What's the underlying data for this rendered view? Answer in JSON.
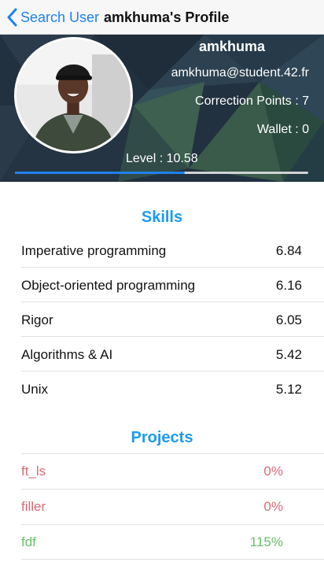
{
  "nav": {
    "back_label": "Search User",
    "title": "amkhuma's Profile"
  },
  "profile": {
    "login": "amkhuma",
    "email": "amkhuma@student.42.fr",
    "correction_points": "Correction Points : 7",
    "wallet": "Wallet : 0",
    "level": "Level : 10.58",
    "level_progress": 0.58
  },
  "skills": {
    "title": "Skills",
    "items": [
      {
        "name": "Imperative programming",
        "value": "6.84"
      },
      {
        "name": "Object-oriented programming",
        "value": "6.16"
      },
      {
        "name": "Rigor",
        "value": "6.05"
      },
      {
        "name": "Algorithms & AI",
        "value": "5.42"
      },
      {
        "name": "Unix",
        "value": "5.12"
      }
    ]
  },
  "projects": {
    "title": "Projects",
    "items": [
      {
        "name": "ft_ls",
        "value": "0%",
        "status": "fail"
      },
      {
        "name": "filler",
        "value": "0%",
        "status": "fail"
      },
      {
        "name": "fdf",
        "value": "115%",
        "status": "ok"
      }
    ]
  },
  "colors": {
    "accent": "#1e82f0",
    "section_title": "#1e9af0",
    "fail": "#d96a77",
    "ok": "#6bbf6b"
  },
  "icons": {
    "back": "chevron-left-icon"
  }
}
